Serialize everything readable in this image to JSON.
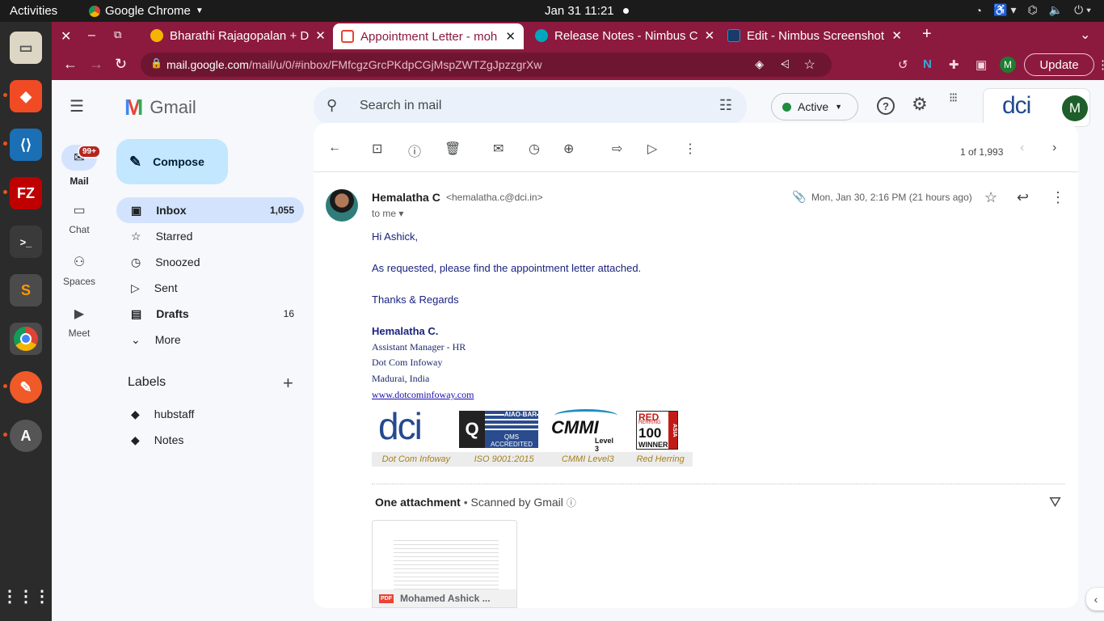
{
  "system": {
    "activities": "Activities",
    "app_name": "Google Chrome",
    "clock": "Jan 31  11:21"
  },
  "dock": {
    "items": [
      "files",
      "bitbucket",
      "vscode",
      "filezilla",
      "terminal",
      "sublime-text",
      "chrome",
      "inkscape",
      "software-updater"
    ],
    "apps_grid": "show-apps"
  },
  "window_controls": {
    "close": "✕",
    "minimize": "–",
    "restore": "⧉"
  },
  "tabs": [
    {
      "label": "Bharathi Rajagopalan + D",
      "favicon_color": "#f4b400"
    },
    {
      "label": "Appointment Letter - moh",
      "favicon_color": "#ea4335"
    },
    {
      "label": "Release Notes - Nimbus C",
      "favicon_color": "#00a6c0"
    },
    {
      "label": "Edit - Nimbus Screenshot",
      "favicon_color": "#00a6c0"
    }
  ],
  "address": {
    "host": "mail.google.com",
    "path": "/mail/u/0/#inbox/FMfcgzGrcPKdpCGjMspZWTZgJpzzgrXw",
    "update_label": "Update",
    "profile_initial": "M"
  },
  "gmail": {
    "logo_text": "Gmail",
    "search_placeholder": "Search in mail",
    "status": "Active",
    "account_initial": "M",
    "org_logo": "dci",
    "rail": [
      {
        "label": "Mail",
        "badge": "99+"
      },
      {
        "label": "Chat"
      },
      {
        "label": "Spaces"
      },
      {
        "label": "Meet"
      }
    ],
    "compose": "Compose",
    "nav": [
      {
        "label": "Inbox",
        "count": "1,055"
      },
      {
        "label": "Starred",
        "count": ""
      },
      {
        "label": "Snoozed",
        "count": ""
      },
      {
        "label": "Sent",
        "count": ""
      },
      {
        "label": "Drafts",
        "count": "16"
      },
      {
        "label": "More",
        "count": ""
      }
    ],
    "labels_title": "Labels",
    "labels": [
      "hubstaff",
      "Notes"
    ],
    "pager": "1 of 1,993"
  },
  "email": {
    "sender_name": "Hemalatha C",
    "sender_email": "<hemalatha.c@dci.in>",
    "to": "to me",
    "date": "Mon, Jan 30, 2:16 PM (21 hours ago)",
    "greeting": "Hi Ashick,",
    "body": "As requested, please find the appointment letter attached.",
    "closing": "Thanks & Regards",
    "sig_name": "Hemalatha C.",
    "sig_title": "Assistant Manager - HR",
    "sig_company": "Dot Com Infoway",
    "sig_location": "Madurai, India",
    "sig_url": "www.dotcominfoway.com",
    "badges": [
      "Dot Com Infoway",
      "ISO 9001:2015",
      "CMMI Level3",
      "Red Herring"
    ],
    "badge_logos": {
      "dci": "dci",
      "qms": "QMS ACCREDITED",
      "aiao": "AIAO-BAR",
      "cmmi": "CMMI",
      "cmmi_level": "Level 3",
      "rh_top": "RED",
      "rh_mid": "100",
      "rh_bottom": "WINNER",
      "rh_side": "ASIA",
      "rh_herring": "HERRING"
    },
    "attachment_title": "One attachment",
    "scanned": "Scanned by Gmail",
    "attachment_name": "Mohamed Ashick ..."
  }
}
